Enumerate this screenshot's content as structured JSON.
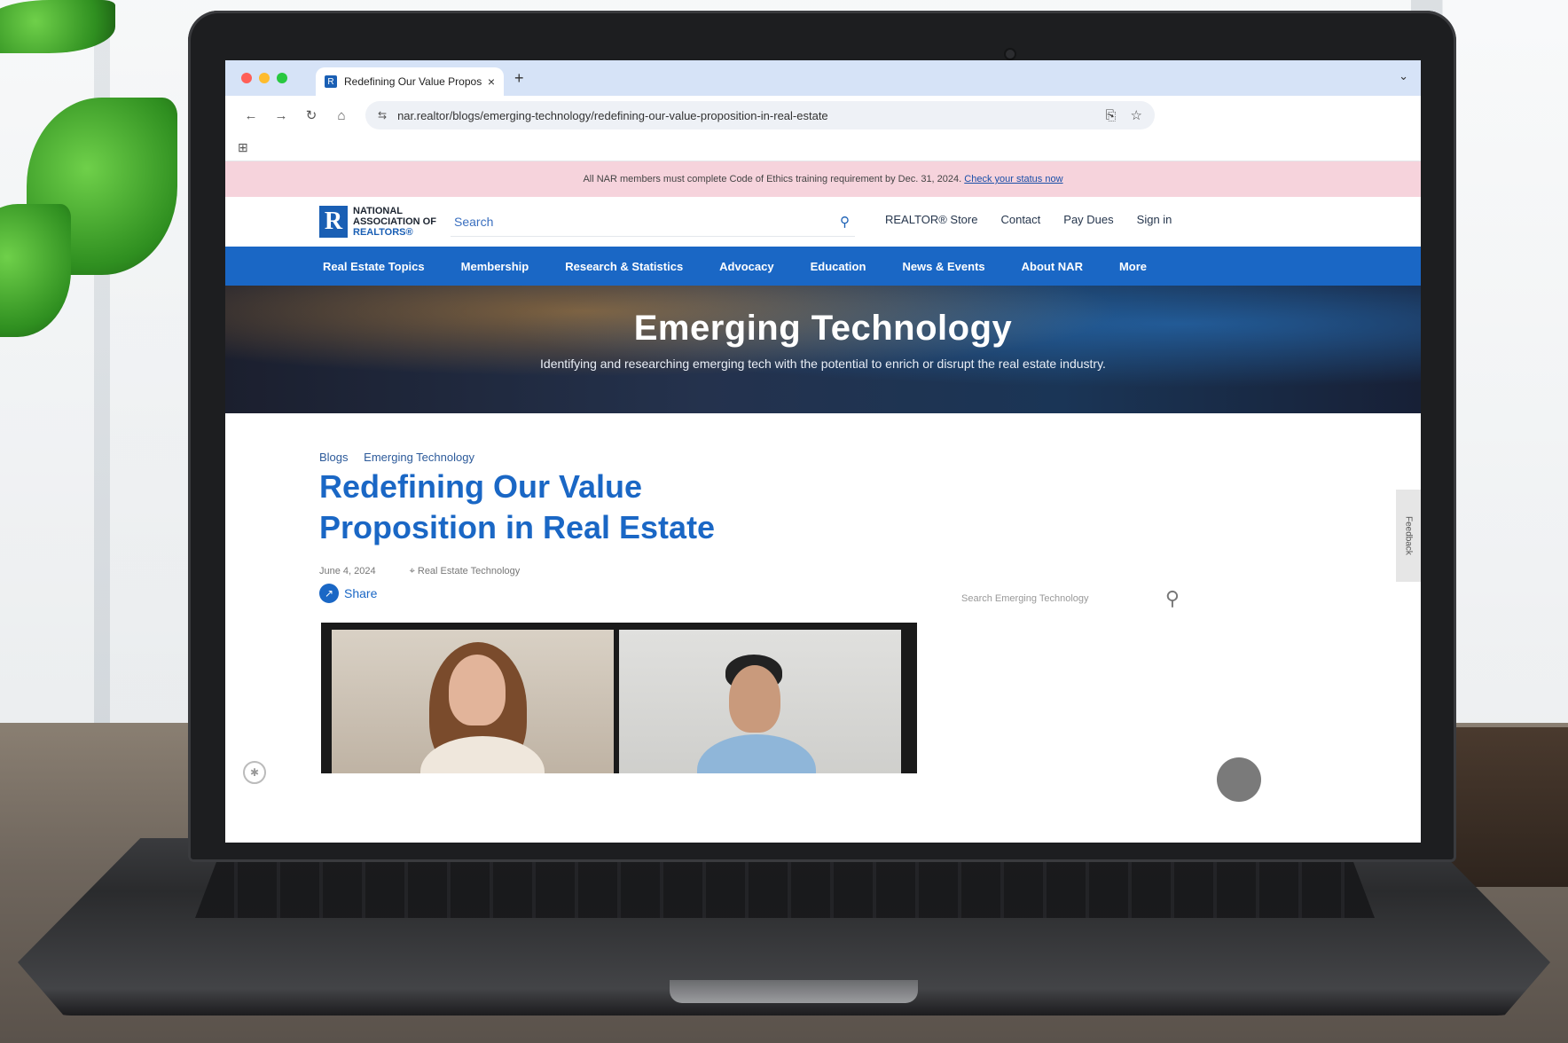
{
  "browser": {
    "tab_title": "Redefining Our Value Proposi",
    "tab_favicon": "R",
    "new_tab": "+",
    "close": "×",
    "url": "nar.realtor/blogs/emerging-technology/redefining-our-value-proposition-in-real-estate"
  },
  "alert": {
    "text": "All NAR members must complete Code of Ethics training requirement by Dec. 31, 2024. ",
    "link": "Check your status now"
  },
  "logo": {
    "mark": "R",
    "line1": "NATIONAL",
    "line2": "ASSOCIATION OF",
    "line3": "REALTORS®"
  },
  "site_search": {
    "placeholder": "Search"
  },
  "util_links": [
    "REALTOR® Store",
    "Contact",
    "Pay Dues",
    "Sign in"
  ],
  "main_nav": [
    "Real Estate Topics",
    "Membership",
    "Research & Statistics",
    "Advocacy",
    "Education",
    "News & Events",
    "About NAR",
    "More"
  ],
  "hero": {
    "title": "Emerging Technology",
    "subtitle": "Identifying and researching emerging tech with the potential to enrich or disrupt the real estate industry."
  },
  "breadcrumb": [
    "Blogs",
    "Emerging Technology"
  ],
  "article": {
    "title": "Redefining Our Value Proposition in Real Estate",
    "date": "June 4, 2024",
    "tag": "Real Estate Technology",
    "share": "Share"
  },
  "sidebar": {
    "search_placeholder": "Search Emerging Technology"
  },
  "feedback": "Feedback",
  "colors": {
    "brand_blue": "#1a67c5",
    "alert_pink": "#f6d3dc"
  },
  "icons": {
    "back": "back-arrow-icon",
    "forward": "forward-arrow-icon",
    "reload": "reload-icon",
    "home": "home-icon",
    "site_info": "tune-icon",
    "bookmark": "star-icon",
    "search": "search-icon",
    "share": "share-icon"
  }
}
